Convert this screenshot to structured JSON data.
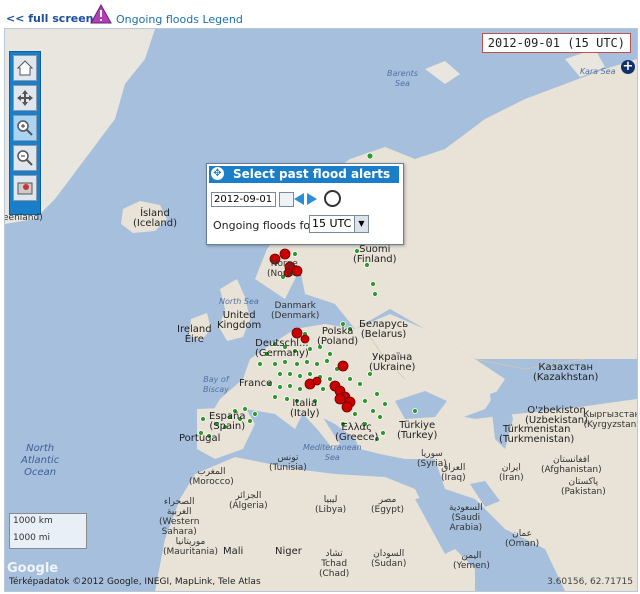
{
  "header": {
    "fullscreen_label": "<< full screen",
    "legend_label": "Ongoing floods Legend"
  },
  "map": {
    "date_display": "2012-09-01 (15 UTC)",
    "zoom_in_button": "+",
    "scale": {
      "km": "1000 km",
      "mi": "1000 mi"
    },
    "attribution": "Térképadatok ©2012 Google, INEGI, MapLink, Tele Atlas",
    "coordinates": "3.60156, 62.71715",
    "google": "Google"
  },
  "panel": {
    "title": "Select past flood alerts",
    "date_value": "2012-09-01",
    "ongoing_label": "Ongoing floods for",
    "utc_selected": "15 UTC"
  },
  "labels": {
    "iceland": "Ísland\n(Iceland)",
    "greenland": "eenland)",
    "barents": "Barents\nSea",
    "kara": "Kara Sea",
    "suomi": "Suomi\n(Finland)",
    "norge": "Norge\n(Norw...",
    "north_sea": "North Sea",
    "danmark": "Danmark\n(Denmark)",
    "polska": "Polska\n(Poland)",
    "belarus": "Беларусь\n(Belarus)",
    "uk": "United\nKingdom",
    "ireland": "Ireland\nÉire",
    "deutschland": "Deutschl...\n(Germany)",
    "ukraina": "Україна\n(Ukraine)",
    "bay_biscay": "Bay of\nBiscay",
    "france": "France",
    "italia": "Italia\n(Italy)",
    "espana": "España\n(Spain)",
    "portugal": "Portugal",
    "kazakhstan": "Казахстан\n(Kazakhstan)",
    "uzbekistan": "O'zbekiston\n(Uzbekistan)",
    "kyrgyzstan": "Кыргызстан\n(Kyrgyzstan)",
    "turkmenistan": "Türkmenistan\n(Turkmenistan)",
    "ellas": "Ελλάς\n(Greece)",
    "turkiye": "Türkiye\n(Turkey)",
    "syria": "سوريا\n(Syria)",
    "iraq": "العراق\n(Iraq)",
    "iran": "ایران\n(Iran)",
    "afghanistan": "افغانستان\n(Afghanistan)",
    "pakistan": "پاکستان\n(Pakistan)",
    "mediterranean": "Mediterranean\nSea",
    "tunisia": "تونس\n(Tunisia)",
    "morocco": "المغرب\n(Morocco)",
    "algeria": "الجزائر\n(Algeria)",
    "libya": "ليبيا\n(Libya)",
    "egypt": "مصر\n(Egypt)",
    "saudi": "السعودية\n(Saudi\nArabia)",
    "oman": "عمان\n(Oman)",
    "yemen": "اليمن\n(Yemen)",
    "north_atlantic": "North\nAtlantic\nOcean",
    "western_sahara": "الصحراء\nالغربية\n(Western\nSahara)",
    "mauritania": "موريتانيا\n(Mauritania)",
    "mali": "Mali",
    "niger": "Niger",
    "tchad": "تشاد\nTchad\n(Chad)",
    "sudan": "السودان\n(Sudan)"
  },
  "colors": {
    "sea": "#a5bfdd",
    "land": "#e8e3d6",
    "panel_header": "#1a7fc8",
    "flood_alert": "#cc0000",
    "flood_station": "#2e9a2e"
  }
}
